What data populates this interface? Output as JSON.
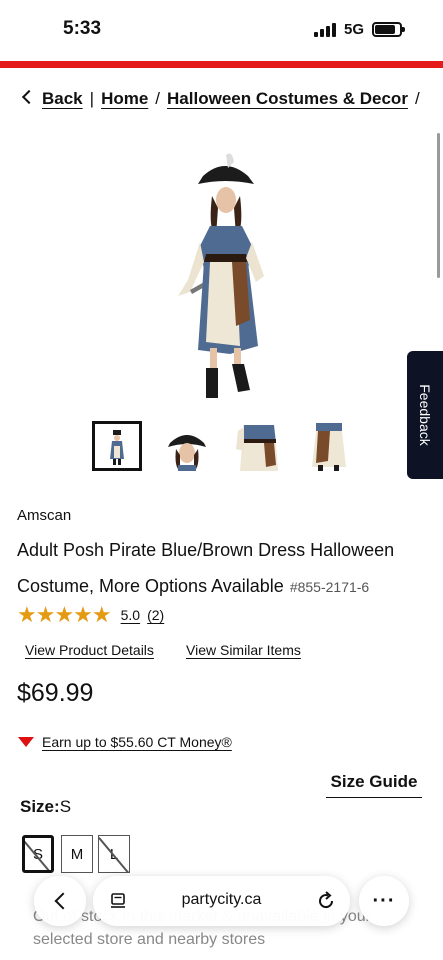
{
  "status_bar": {
    "time": "5:33",
    "network": "5G"
  },
  "breadcrumb": {
    "back": "Back",
    "divider": "|",
    "items": [
      "Home",
      "Halloween Costumes & Decor"
    ],
    "separator": "/"
  },
  "feedback_tab": "Feedback",
  "product": {
    "brand": "Amscan",
    "title": "Adult Posh Pirate Blue/Brown Dress Halloween Costume, More Options Available",
    "sku": "#855-2171-6",
    "rating_value": "5.0",
    "rating_count": "(2)",
    "stars": 5,
    "view_details": "View Product Details",
    "view_similar": "View Similar Items",
    "price": "$69.99",
    "ct_money": "Earn up to $55.60 CT Money®",
    "size_guide": "Size Guide",
    "size_label": "Size:",
    "size_selected": "S",
    "sizes": [
      "S",
      "M",
      "L"
    ],
    "availability": "Out of stock in this market & unavailable in your selected store and nearby stores"
  },
  "browser_bar": {
    "url": "partycity.ca",
    "more": "···"
  },
  "colors": {
    "accent_red": "#e51a1a",
    "star": "#e49a12",
    "feedback_bg": "#0d1324"
  }
}
